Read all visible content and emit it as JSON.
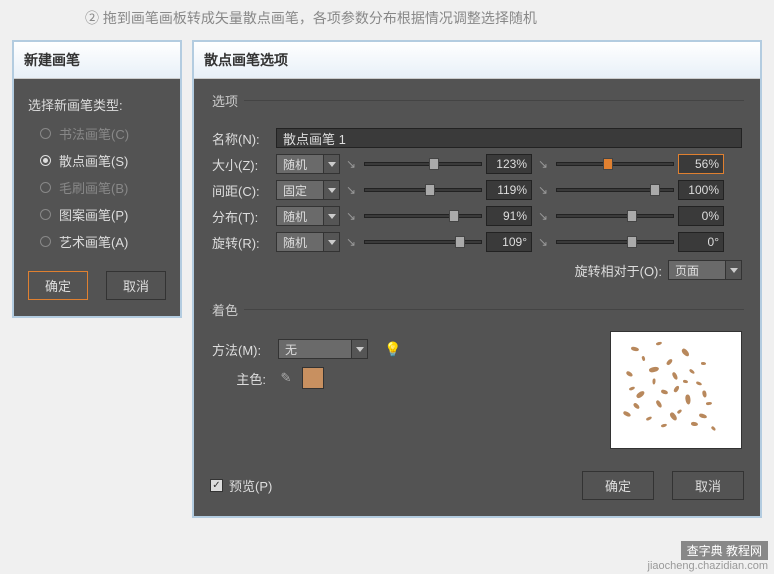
{
  "caption": "② 拖到画笔画板转成矢量散点画笔，各项参数分布根据情况调整选择随机",
  "left": {
    "title": "新建画笔",
    "select_label": "选择新画笔类型:",
    "options": [
      {
        "label": "书法画笔(C)",
        "selected": false,
        "enabled": false
      },
      {
        "label": "散点画笔(S)",
        "selected": true,
        "enabled": true
      },
      {
        "label": "毛刷画笔(B)",
        "selected": false,
        "enabled": false
      },
      {
        "label": "图案画笔(P)",
        "selected": false,
        "enabled": true
      },
      {
        "label": "艺术画笔(A)",
        "selected": false,
        "enabled": true
      }
    ],
    "ok": "确定",
    "cancel": "取消"
  },
  "right": {
    "title": "散点画笔选项",
    "section_options": "选项",
    "name_label": "名称(N):",
    "name_value": "散点画笔 1",
    "rows": [
      {
        "label": "大小(Z):",
        "mode": "随机",
        "val1": "123%",
        "pos1": 55,
        "val2": "56%",
        "pos2": 40,
        "hl2": true
      },
      {
        "label": "间距(C):",
        "mode": "固定",
        "val1": "119%",
        "pos1": 52,
        "val2": "100%",
        "pos2": 80,
        "hl2": false
      },
      {
        "label": "分布(T):",
        "mode": "随机",
        "val1": "91%",
        "pos1": 72,
        "val2": "0%",
        "pos2": 60,
        "hl2": false
      },
      {
        "label": "旋转(R):",
        "mode": "随机",
        "val1": "109°",
        "pos1": 78,
        "val2": "0°",
        "pos2": 60,
        "hl2": false
      }
    ],
    "rotation_relative_label": "旋转相对于(O):",
    "rotation_relative_value": "页面",
    "section_colorize": "着色",
    "method_label": "方法(M):",
    "method_value": "无",
    "keycolor_label": "主色:",
    "swatch_color": "#c89060",
    "preview_checkbox": "预览(P)",
    "ok": "确定",
    "cancel": "取消"
  },
  "watermark": {
    "line1": "查字典 教程网",
    "line2": "jiaocheng.chazidian.com"
  }
}
